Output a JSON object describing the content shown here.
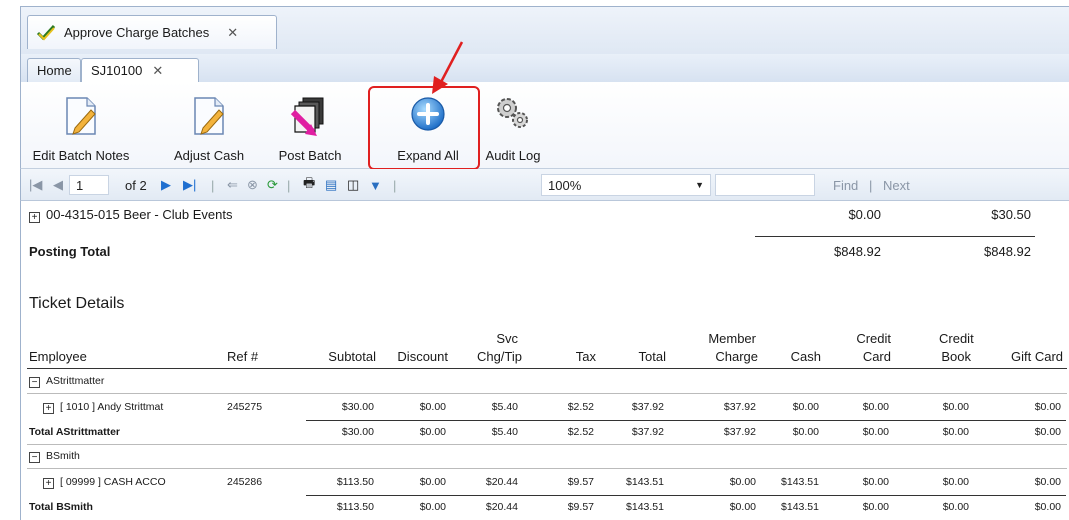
{
  "window": {
    "doc_tab": {
      "label": "Approve Charge Batches",
      "close": "✕"
    },
    "inner_tabs": [
      {
        "label": "Home"
      },
      {
        "label": "SJ10100",
        "close": "✕"
      }
    ]
  },
  "toolbar": {
    "edit_batch_notes": "Edit Batch Notes",
    "adjust_cash": "Adjust Cash",
    "post_batch": "Post Batch",
    "expand_all": "Expand All",
    "audit_log": "Audit Log"
  },
  "navbar": {
    "current_page": "1",
    "of_pages": "of 2",
    "zoom": "100%",
    "find": "Find",
    "separator": "|",
    "next": "Next"
  },
  "report": {
    "account_row": {
      "label": "00-4315-015 Beer - Club Events",
      "col1": "$0.00",
      "col2": "$30.50"
    },
    "posting_total": {
      "label": "Posting Total",
      "col1": "$848.92",
      "col2": "$848.92"
    },
    "section_title": "Ticket Details",
    "columns": {
      "employee": "Employee",
      "ref": "Ref #",
      "subtotal": "Subtotal",
      "discount": "Discount",
      "svc_top": "Svc",
      "svc_bottom": "Chg/Tip",
      "tax": "Tax",
      "total": "Total",
      "member_top": "Member",
      "member_bottom": "Charge",
      "cash": "Cash",
      "credit_card_top": "Credit",
      "credit_card_bottom": "Card",
      "credit_book_top": "Credit",
      "credit_book_bottom": "Book",
      "gift_card": "Gift Card"
    },
    "groups": [
      {
        "name": "AStrittmatter",
        "detail": {
          "label": "[ 1010 ] Andy Strittmat",
          "ref": "245275",
          "values": [
            "$30.00",
            "$0.00",
            "$5.40",
            "$2.52",
            "$37.92",
            "$37.92",
            "$0.00",
            "$0.00",
            "$0.00",
            "$0.00"
          ]
        },
        "total": {
          "label": "Total AStrittmatter",
          "values": [
            "$30.00",
            "$0.00",
            "$5.40",
            "$2.52",
            "$37.92",
            "$37.92",
            "$0.00",
            "$0.00",
            "$0.00",
            "$0.00"
          ]
        }
      },
      {
        "name": "BSmith",
        "detail": {
          "label": "[ 09999 ] CASH ACCO",
          "ref": "245286",
          "values": [
            "$113.50",
            "$0.00",
            "$20.44",
            "$9.57",
            "$143.51",
            "$0.00",
            "$143.51",
            "$0.00",
            "$0.00",
            "$0.00"
          ]
        },
        "total": {
          "label": "Total BSmith",
          "values": [
            "$113.50",
            "$0.00",
            "$20.44",
            "$9.57",
            "$143.51",
            "$0.00",
            "$143.51",
            "$0.00",
            "$0.00",
            "$0.00"
          ]
        }
      }
    ],
    "expand_glyph": "+",
    "collapse_glyph": "−"
  }
}
